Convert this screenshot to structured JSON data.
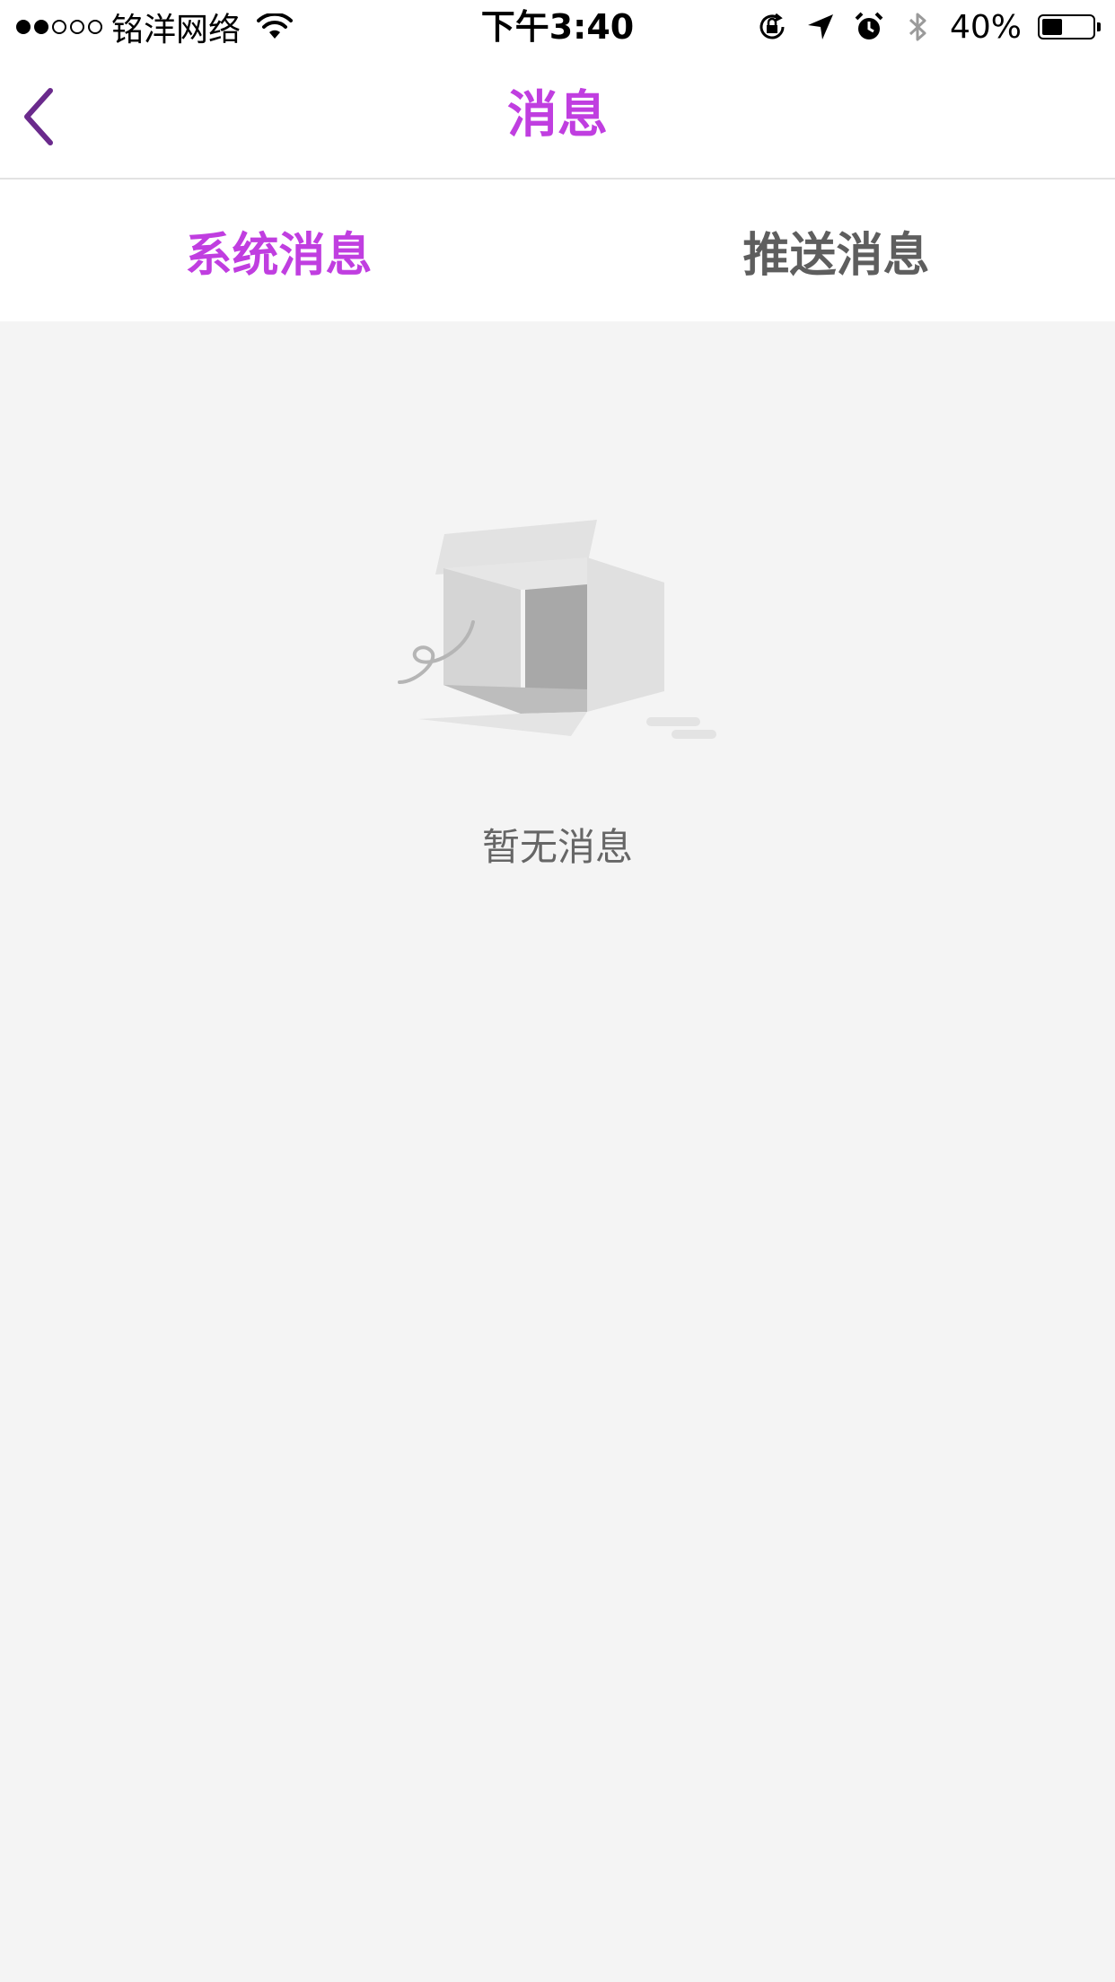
{
  "status_bar": {
    "signal_bars_on": 2,
    "signal_bars_total": 5,
    "carrier": "铭洋网络",
    "time": "下午3:40",
    "battery_text": "40%",
    "battery_level": 0.4,
    "icons": [
      "wifi-icon",
      "rotation-lock-icon",
      "location-arrow-icon",
      "alarm-icon",
      "bluetooth-icon",
      "battery-icon"
    ]
  },
  "nav": {
    "back_icon": "chevron-left-icon",
    "title": "消息"
  },
  "tabs": [
    {
      "label": "系统消息",
      "active": true
    },
    {
      "label": "推送消息",
      "active": false
    }
  ],
  "empty_state": {
    "icon": "empty-box-icon",
    "text": "暂无消息"
  },
  "colors": {
    "accent": "#c03ee0",
    "back_icon": "#6a2a8c",
    "tab_inactive": "#5e5e5e",
    "background": "#f4f4f4",
    "empty_text": "#666666"
  }
}
